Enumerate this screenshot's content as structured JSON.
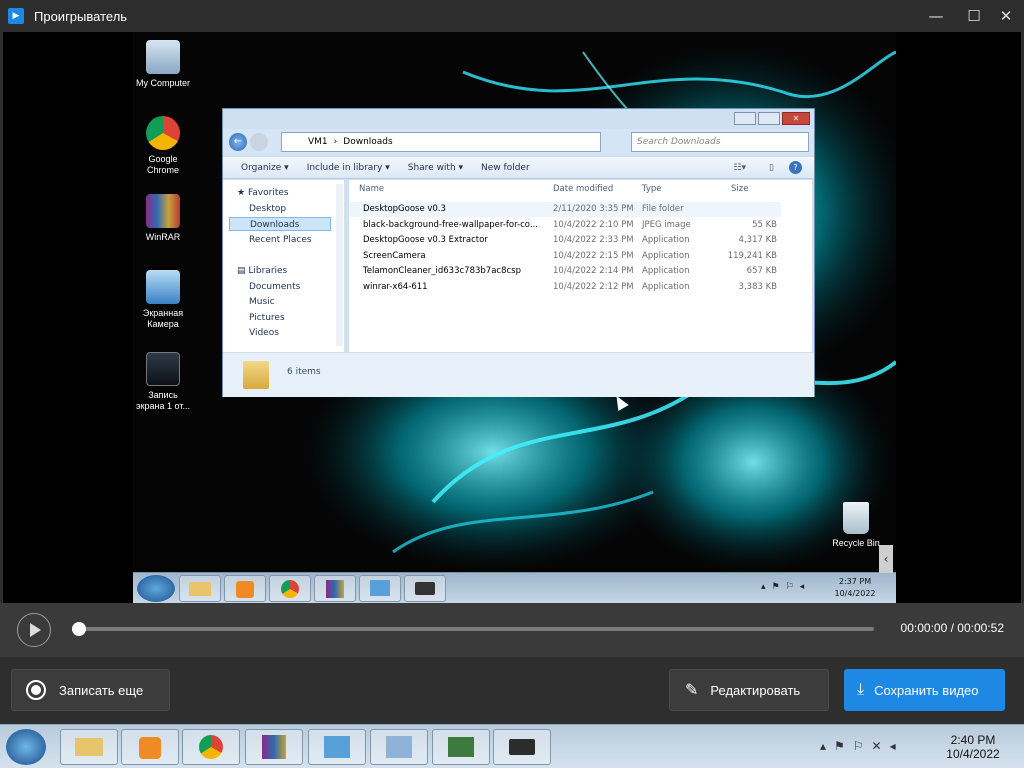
{
  "app": {
    "title": "Проигрыватель",
    "logo_icon": "play-logo-icon"
  },
  "window_controls": {
    "minimize": "—",
    "maximize": "☐",
    "close": "✕"
  },
  "desktop_icons": [
    {
      "label": "My Computer",
      "icon": "computer-icon"
    },
    {
      "label": "Google Chrome",
      "icon": "chrome-icon"
    },
    {
      "label": "WinRAR",
      "icon": "winrar-icon"
    },
    {
      "label": "Экранная Камера",
      "icon": "screen-camera-icon"
    },
    {
      "label": "Запись экрана 1 от...",
      "icon": "video-file-icon"
    },
    {
      "label": "Recycle Bin",
      "icon": "recycle-bin-icon"
    }
  ],
  "explorer": {
    "breadcrumb": [
      "VM1",
      "Downloads"
    ],
    "search_placeholder": "Search Downloads",
    "toolbar": {
      "organize": "Organize ▾",
      "include": "Include in library ▾",
      "share": "Share with ▾",
      "new_folder": "New folder"
    },
    "nav": {
      "favorites": "Favorites",
      "desktop": "Desktop",
      "downloads": "Downloads",
      "recent": "Recent Places",
      "libraries": "Libraries",
      "documents": "Documents",
      "music": "Music",
      "pictures": "Pictures",
      "videos": "Videos"
    },
    "columns": {
      "name": "Name",
      "date": "Date modified",
      "type": "Type",
      "size": "Size"
    },
    "files": [
      {
        "name": "DesktopGoose v0.3",
        "date": "2/11/2020 3:35 PM",
        "type": "File folder",
        "size": ""
      },
      {
        "name": "black-background-free-wallpaper-for-co...",
        "date": "10/4/2022 2:10 PM",
        "type": "JPEG image",
        "size": "55 KB"
      },
      {
        "name": "DesktopGoose v0.3 Extractor",
        "date": "10/4/2022 2:33 PM",
        "type": "Application",
        "size": "4,317 KB"
      },
      {
        "name": "ScreenCamera",
        "date": "10/4/2022 2:15 PM",
        "type": "Application",
        "size": "119,241 KB"
      },
      {
        "name": "TelamonCleaner_id633c783b7ac8csp",
        "date": "10/4/2022 2:14 PM",
        "type": "Application",
        "size": "657 KB"
      },
      {
        "name": "winrar-x64-611",
        "date": "10/4/2022 2:12 PM",
        "type": "Application",
        "size": "3,383 KB"
      }
    ],
    "status": "6 items"
  },
  "vm_clock": {
    "time": "2:37 PM",
    "date": "10/4/2022"
  },
  "player": {
    "current": "00:00:00",
    "duration": "00:00:52",
    "progress": 0.0
  },
  "actions": {
    "record_again": "Записать еще",
    "edit": "Редактировать",
    "save": "Сохранить видео"
  },
  "host_clock": {
    "time": "2:40 PM",
    "date": "10/4/2022"
  },
  "colors": {
    "accent": "#1e88e5",
    "save_button": "#1e88e5",
    "glow": "#00d0e0"
  }
}
